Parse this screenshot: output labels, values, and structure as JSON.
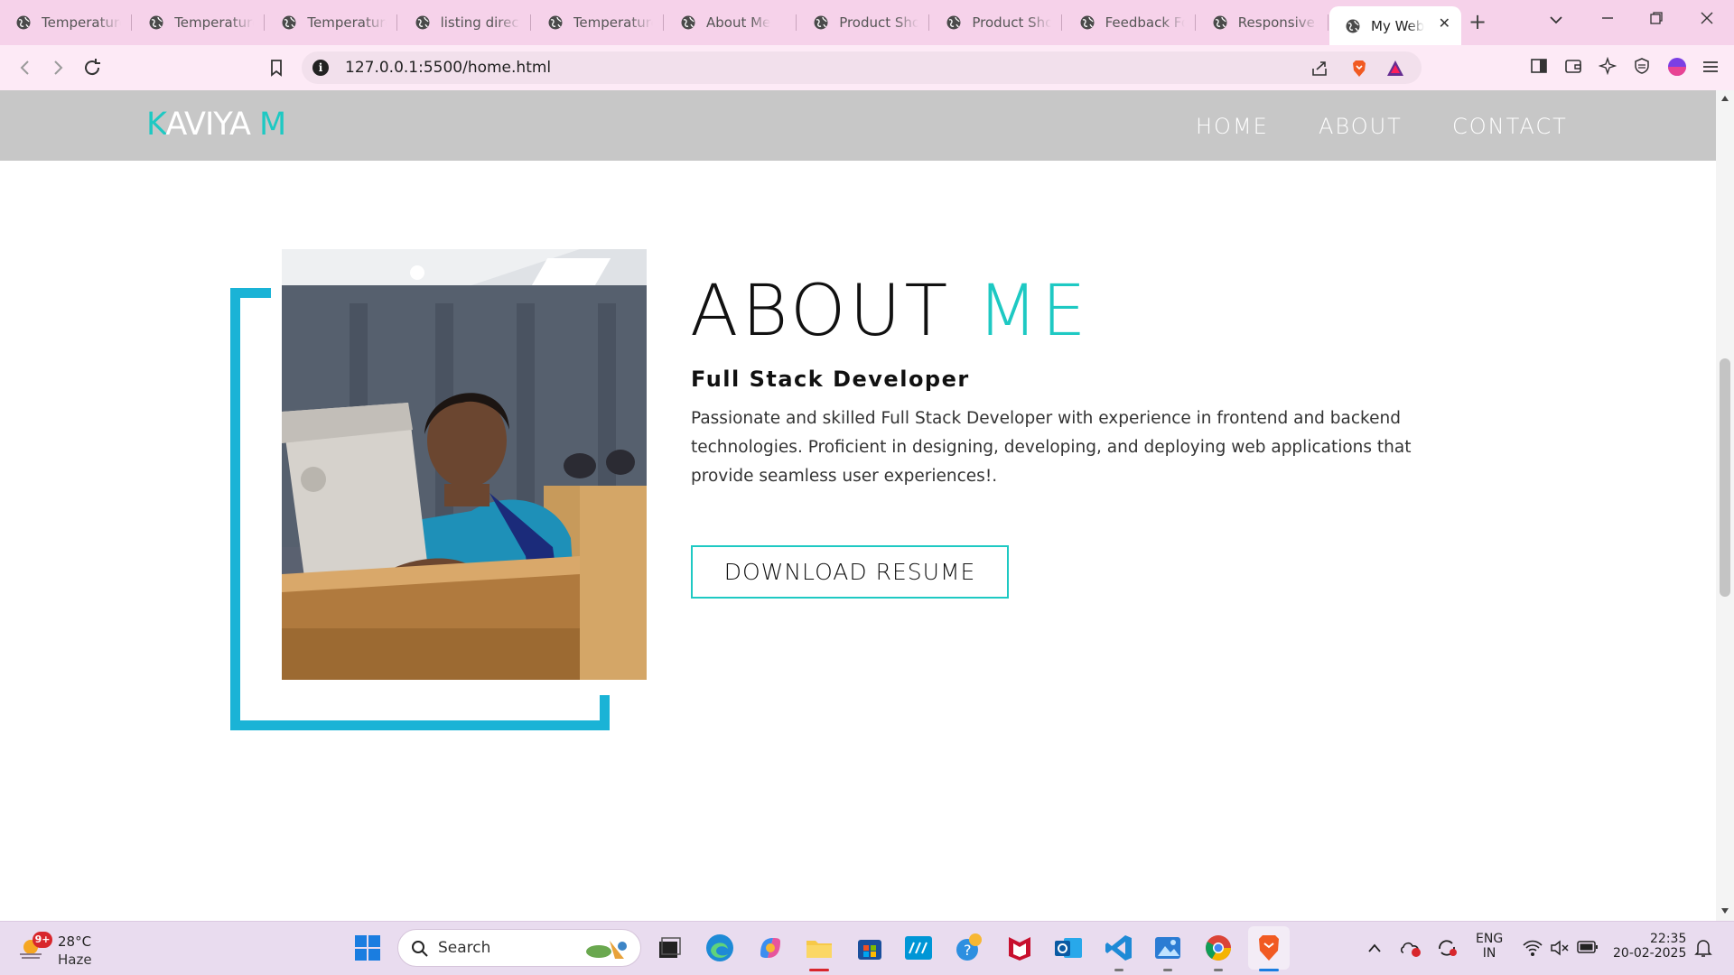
{
  "browser": {
    "tabs": [
      {
        "label": "Temperature",
        "active": false
      },
      {
        "label": "Temperature",
        "active": false
      },
      {
        "label": "Temperature",
        "active": false
      },
      {
        "label": "listing directo",
        "active": false
      },
      {
        "label": "Temperature",
        "active": false
      },
      {
        "label": "About Me",
        "active": false
      },
      {
        "label": "Product Show",
        "active": false
      },
      {
        "label": "Product Show",
        "active": false
      },
      {
        "label": "Feedback Fo",
        "active": false
      },
      {
        "label": "Responsive E",
        "active": false
      },
      {
        "label": "My Web",
        "active": true
      }
    ],
    "url": "127.0.0.1:5500/home.html",
    "tab_close_glyph": "✕",
    "new_tab_glyph": "+"
  },
  "site": {
    "logo_first": "K",
    "logo_middle": "AVIYA ",
    "logo_last": "M",
    "nav": [
      "HOME",
      "ABOUT",
      "CONTACT"
    ],
    "about_title": "ABOUT",
    "about_title_accent": "ME",
    "subtitle": "Full Stack Developer",
    "description": "Passionate and skilled Full Stack Developer with experience in frontend and backend technologies. Proficient in designing, developing, and deploying web applications that provide seamless user experiences!.",
    "resume_button": "DOWNLOAD RESUME",
    "colors": {
      "accent": "#1ec9c3",
      "frame": "#1ab3d6",
      "header": "#c7c7c7"
    }
  },
  "taskbar": {
    "weather_badge": "9+",
    "temperature": "28°C",
    "condition": "Haze",
    "search_label": "Search",
    "lang_line1": "ENG",
    "lang_line2": "IN",
    "time": "22:35",
    "date": "20-02-2025"
  }
}
